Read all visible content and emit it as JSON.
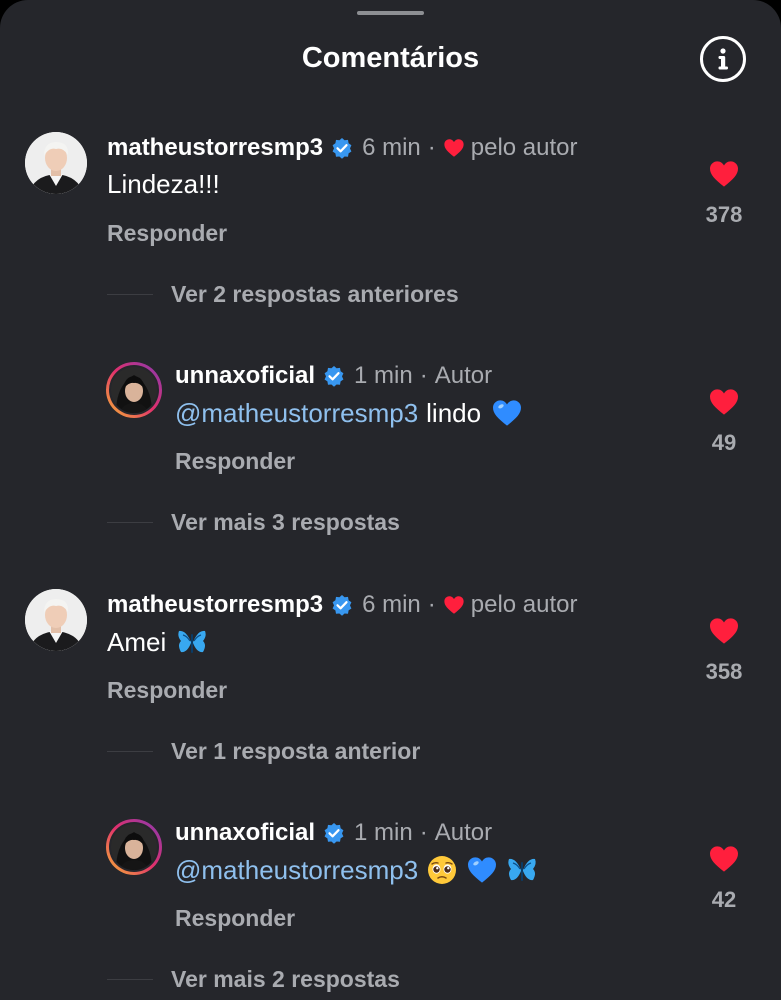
{
  "sheet": {
    "title": "Comentários",
    "info_icon": "info-circle-icon"
  },
  "threads": [
    {
      "comment": {
        "username": "matheustorresmp3",
        "verified": true,
        "time": "6 min",
        "separator": "·",
        "liked_by_label": "pelo autor",
        "text": "Lindeza!!!",
        "reply_label": "Responder",
        "like_count": "378",
        "liked": true
      },
      "view_replies_label": "Ver 2 respostas anteriores",
      "reply": {
        "username": "unnaxoficial",
        "verified": true,
        "time": "1 min",
        "separator": "·",
        "author_badge": "Autor",
        "mention": "@matheustorresmp3",
        "text": "lindo",
        "emojis": [
          "blue-heart-emoji"
        ],
        "reply_label": "Responder",
        "like_count": "49",
        "liked": true
      },
      "view_more_label": "Ver mais 3 respostas"
    },
    {
      "comment": {
        "username": "matheustorresmp3",
        "verified": true,
        "time": "6 min",
        "separator": "·",
        "liked_by_label": "pelo autor",
        "text": "Amei",
        "emojis": [
          "butterfly-emoji"
        ],
        "reply_label": "Responder",
        "like_count": "358",
        "liked": true
      },
      "view_replies_label": "Ver 1 resposta anterior",
      "reply": {
        "username": "unnaxoficial",
        "verified": true,
        "time": "1 min",
        "separator": "·",
        "author_badge": "Autor",
        "mention": "@matheustorresmp3",
        "text": "",
        "emojis": [
          "pleading-face-emoji",
          "blue-heart-emoji",
          "butterfly-emoji"
        ],
        "reply_label": "Responder",
        "like_count": "42",
        "liked": true
      },
      "view_more_label": "Ver mais 2 respostas"
    }
  ],
  "colors": {
    "background": "#25262b",
    "heart": "#ff1f3d",
    "verified": "#3897f0",
    "mention": "#8fc0ee",
    "secondary_text": "#a9abb0"
  }
}
